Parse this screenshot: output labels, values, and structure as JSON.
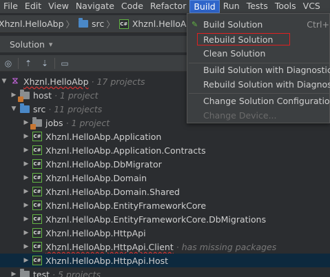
{
  "menubar": {
    "items": [
      {
        "label": "File"
      },
      {
        "label": "Edit"
      },
      {
        "label": "View"
      },
      {
        "label": "Navigate"
      },
      {
        "label": "Code"
      },
      {
        "label": "Refactor"
      },
      {
        "label": "Build"
      },
      {
        "label": "Run"
      },
      {
        "label": "Tests"
      },
      {
        "label": "Tools"
      },
      {
        "label": "VCS"
      }
    ],
    "active": "Build"
  },
  "breadcrumb": {
    "items": [
      {
        "label": "Xhznl.HelloAbp",
        "icon": "solution-icon"
      },
      {
        "label": "src",
        "icon": "folder-icon"
      },
      {
        "label": "Xhznl.HelloAbp.Htt",
        "icon": "csharp-project-icon"
      }
    ]
  },
  "panel": {
    "title": "Solution",
    "chevron": "▾"
  },
  "tree": {
    "root": {
      "label": "Xhznl.HelloAbp",
      "meta": "· 17 projects"
    },
    "rows": [
      {
        "label": "host",
        "meta": "· 1 project",
        "type": "folder",
        "arrow": "▶"
      },
      {
        "label": "src",
        "meta": "· 11 projects",
        "type": "src-folder",
        "arrow": "▼"
      },
      {
        "label": "jobs",
        "meta": "· 1 project",
        "type": "folder",
        "arrow": "▶"
      },
      {
        "label": "Xhznl.HelloAbp.Application",
        "type": "cs",
        "arrow": "▶"
      },
      {
        "label": "Xhznl.HelloAbp.Application.Contracts",
        "type": "cs",
        "arrow": "▶"
      },
      {
        "label": "Xhznl.HelloAbp.DbMigrator",
        "type": "cs",
        "arrow": "▶"
      },
      {
        "label": "Xhznl.HelloAbp.Domain",
        "type": "cs",
        "arrow": "▶"
      },
      {
        "label": "Xhznl.HelloAbp.Domain.Shared",
        "type": "cs",
        "arrow": "▶"
      },
      {
        "label": "Xhznl.HelloAbp.EntityFrameworkCore",
        "type": "cs",
        "arrow": "▶"
      },
      {
        "label": "Xhznl.HelloAbp.EntityFrameworkCore.DbMigrations",
        "type": "cs",
        "arrow": "▶"
      },
      {
        "label": "Xhznl.HelloAbp.HttpApi",
        "type": "cs",
        "arrow": "▶"
      },
      {
        "label": "Xhznl.HelloAbp.HttpApi.Client",
        "meta": "· has missing packages",
        "type": "cs",
        "arrow": "▶"
      },
      {
        "label": "Xhznl.HelloAbp.HttpApi.Host",
        "type": "cs",
        "arrow": "▶"
      },
      {
        "label": "test",
        "meta": "· 5 projects",
        "type": "folder",
        "arrow": "▶"
      }
    ]
  },
  "dropdown": {
    "items": [
      {
        "label": "Build Solution",
        "shortcut": "Ctrl+"
      },
      {
        "label": "Rebuild Solution"
      },
      {
        "label": "Clean Solution"
      },
      {
        "label": "Build Solution with Diagnostics"
      },
      {
        "label": "Rebuild Solution with Diagnostic"
      },
      {
        "label": "Change Solution Configuration..."
      },
      {
        "label": "Change Device..."
      }
    ]
  },
  "colors": {
    "menu_active": "#2f65ca",
    "highlight_box": "#e02020",
    "selected_row": "#0d293e",
    "csharp_project": "#62b543",
    "solution": "#b45ec9"
  }
}
